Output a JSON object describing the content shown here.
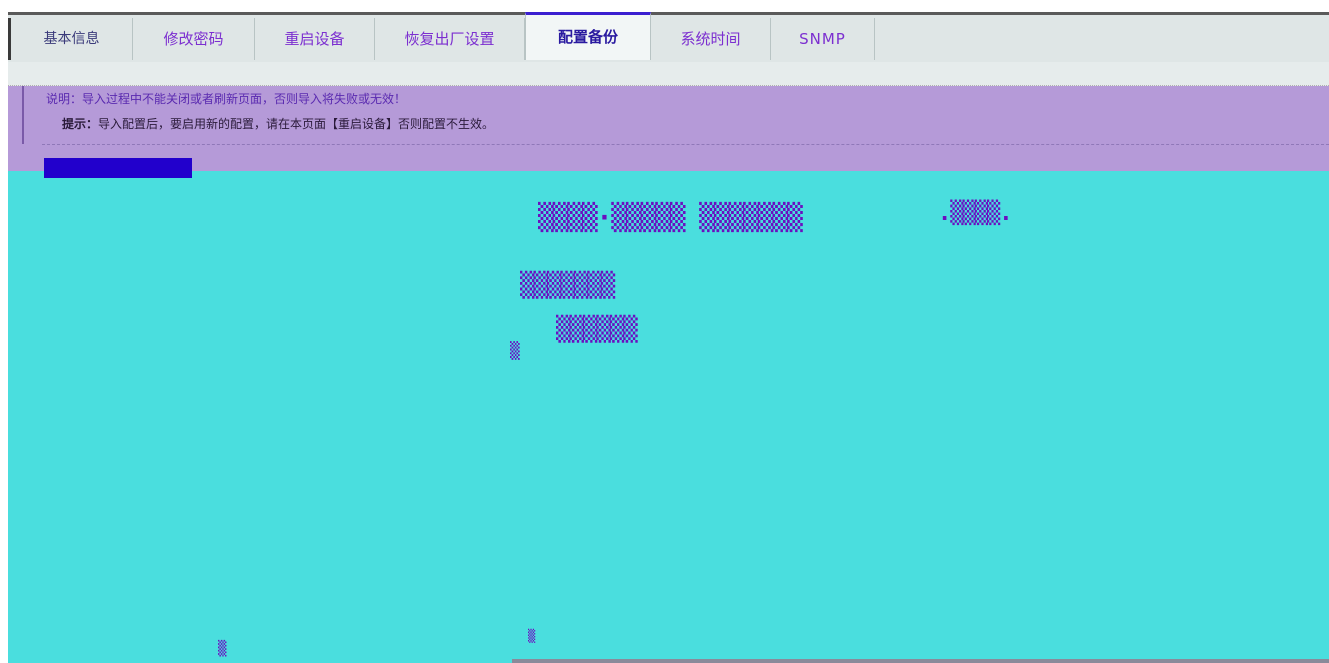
{
  "tabs": [
    {
      "label": "基本信息"
    },
    {
      "label": "修改密码"
    },
    {
      "label": "重启设备"
    },
    {
      "label": "恢复出厂设置"
    },
    {
      "label": "配置备份"
    },
    {
      "label": "系统时间"
    },
    {
      "label": "SNMP"
    }
  ],
  "notice": {
    "line1": "说明：导入过程中不能关闭或者刷新页面，否则导入将失败或无效！",
    "line2_prefix": "提示：",
    "line2_text": "导入配置后，要启用新的配置，请在本页面【重启设备】否则配置不生效。"
  },
  "colors": {
    "content_bg": "#4adede",
    "notice_bg": "#b59ad8",
    "active_tab_border": "#3b1fd0"
  }
}
